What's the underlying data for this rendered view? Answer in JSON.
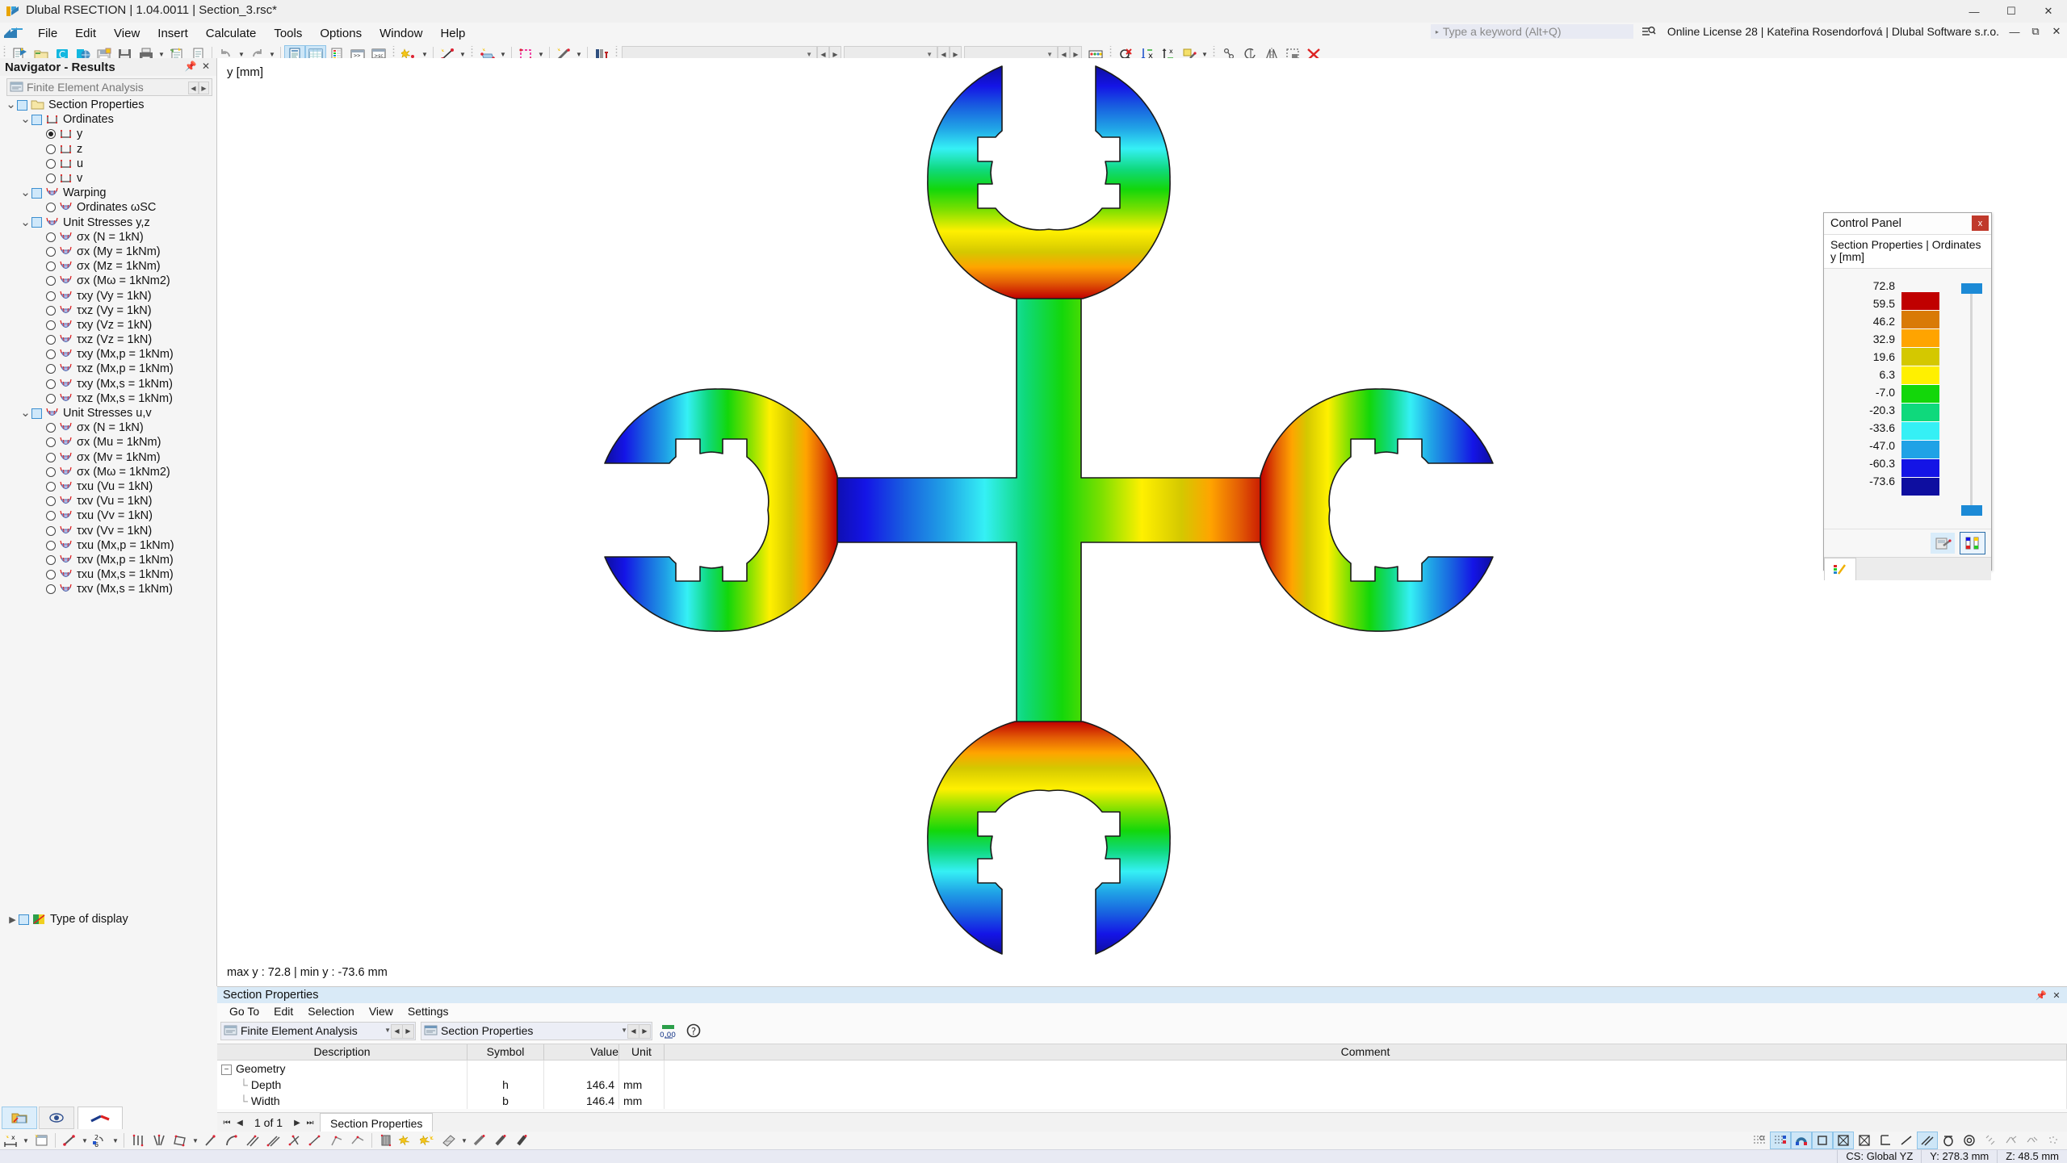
{
  "window": {
    "title": "Dlubal RSECTION | 1.04.0011 | Section_3.rsc*",
    "min_label": "—",
    "max_label": "☐",
    "close_label": "✕"
  },
  "menubar": {
    "items": [
      {
        "label": "File"
      },
      {
        "label": "Edit"
      },
      {
        "label": "View"
      },
      {
        "label": "Insert"
      },
      {
        "label": "Calculate"
      },
      {
        "label": "Tools"
      },
      {
        "label": "Options"
      },
      {
        "label": "Window"
      },
      {
        "label": "Help"
      }
    ]
  },
  "topright": {
    "search_placeholder": "Type a keyword (Alt+Q)",
    "license": "Online License 28 | Kateřina Rosendorfová | Dlubal Software s.r.o."
  },
  "navigator": {
    "title": "Navigator - Results",
    "pin_icon": "pin-icon",
    "close_icon": "close-icon",
    "combo_value": "Finite Element Analysis",
    "tree": [
      {
        "level": 0,
        "ctrl": "checkbox",
        "expander": "down",
        "icon": "folder-icon",
        "label": "Section Properties"
      },
      {
        "level": 1,
        "ctrl": "checkbox",
        "expander": "down",
        "icon": "section-icon",
        "label": "Ordinates"
      },
      {
        "level": 2,
        "ctrl": "radio-selected",
        "expander": "none",
        "icon": "section-icon",
        "label": "y"
      },
      {
        "level": 2,
        "ctrl": "radio",
        "expander": "none",
        "icon": "section-icon",
        "label": "z"
      },
      {
        "level": 2,
        "ctrl": "radio",
        "expander": "none",
        "icon": "section-icon",
        "label": "u"
      },
      {
        "level": 2,
        "ctrl": "radio",
        "expander": "none",
        "icon": "section-icon",
        "label": "v"
      },
      {
        "level": 1,
        "ctrl": "checkbox",
        "expander": "down",
        "icon": "stress-icon",
        "label": "Warping"
      },
      {
        "level": 2,
        "ctrl": "radio",
        "expander": "none",
        "icon": "stress-icon",
        "label": "Ordinates ωSC"
      },
      {
        "level": 1,
        "ctrl": "checkbox",
        "expander": "down",
        "icon": "stress-icon",
        "label": "Unit Stresses y,z"
      },
      {
        "level": 2,
        "ctrl": "radio",
        "expander": "none",
        "icon": "stress-icon",
        "label": "σx (N = 1kN)"
      },
      {
        "level": 2,
        "ctrl": "radio",
        "expander": "none",
        "icon": "stress-icon",
        "label": "σx (My = 1kNm)"
      },
      {
        "level": 2,
        "ctrl": "radio",
        "expander": "none",
        "icon": "stress-icon",
        "label": "σx (Mz = 1kNm)"
      },
      {
        "level": 2,
        "ctrl": "radio",
        "expander": "none",
        "icon": "stress-icon",
        "label": "σx (Mω = 1kNm2)"
      },
      {
        "level": 2,
        "ctrl": "radio",
        "expander": "none",
        "icon": "stress-icon",
        "label": "τxy (Vy = 1kN)"
      },
      {
        "level": 2,
        "ctrl": "radio",
        "expander": "none",
        "icon": "stress-icon",
        "label": "τxz (Vy = 1kN)"
      },
      {
        "level": 2,
        "ctrl": "radio",
        "expander": "none",
        "icon": "stress-icon",
        "label": "τxy (Vz = 1kN)"
      },
      {
        "level": 2,
        "ctrl": "radio",
        "expander": "none",
        "icon": "stress-icon",
        "label": "τxz (Vz = 1kN)"
      },
      {
        "level": 2,
        "ctrl": "radio",
        "expander": "none",
        "icon": "stress-icon",
        "label": "τxy (Mx,p = 1kNm)"
      },
      {
        "level": 2,
        "ctrl": "radio",
        "expander": "none",
        "icon": "stress-icon",
        "label": "τxz (Mx,p = 1kNm)"
      },
      {
        "level": 2,
        "ctrl": "radio",
        "expander": "none",
        "icon": "stress-icon",
        "label": "τxy (Mx,s = 1kNm)"
      },
      {
        "level": 2,
        "ctrl": "radio",
        "expander": "none",
        "icon": "stress-icon",
        "label": "τxz (Mx,s = 1kNm)"
      },
      {
        "level": 1,
        "ctrl": "checkbox",
        "expander": "down",
        "icon": "stress-icon",
        "label": "Unit Stresses u,v"
      },
      {
        "level": 2,
        "ctrl": "radio",
        "expander": "none",
        "icon": "stress-icon",
        "label": "σx (N = 1kN)"
      },
      {
        "level": 2,
        "ctrl": "radio",
        "expander": "none",
        "icon": "stress-icon",
        "label": "σx (Mu = 1kNm)"
      },
      {
        "level": 2,
        "ctrl": "radio",
        "expander": "none",
        "icon": "stress-icon",
        "label": "σx (Mv = 1kNm)"
      },
      {
        "level": 2,
        "ctrl": "radio",
        "expander": "none",
        "icon": "stress-icon",
        "label": "σx (Mω = 1kNm2)"
      },
      {
        "level": 2,
        "ctrl": "radio",
        "expander": "none",
        "icon": "stress-icon",
        "label": "τxu (Vu = 1kN)"
      },
      {
        "level": 2,
        "ctrl": "radio",
        "expander": "none",
        "icon": "stress-icon",
        "label": "τxv (Vu = 1kN)"
      },
      {
        "level": 2,
        "ctrl": "radio",
        "expander": "none",
        "icon": "stress-icon",
        "label": "τxu (Vv = 1kN)"
      },
      {
        "level": 2,
        "ctrl": "radio",
        "expander": "none",
        "icon": "stress-icon",
        "label": "τxv (Vv = 1kN)"
      },
      {
        "level": 2,
        "ctrl": "radio",
        "expander": "none",
        "icon": "stress-icon",
        "label": "τxu (Mx,p = 1kNm)"
      },
      {
        "level": 2,
        "ctrl": "radio",
        "expander": "none",
        "icon": "stress-icon",
        "label": "τxv (Mx,p = 1kNm)"
      },
      {
        "level": 2,
        "ctrl": "radio",
        "expander": "none",
        "icon": "stress-icon",
        "label": "τxu (Mx,s = 1kNm)"
      },
      {
        "level": 2,
        "ctrl": "radio",
        "expander": "none",
        "icon": "stress-icon",
        "label": "τxv (Mx,s = 1kNm)"
      }
    ],
    "type_of_display": {
      "label": "Type of display",
      "expander": "right",
      "icon": "display-icon"
    }
  },
  "view": {
    "axis_label": "y [mm]",
    "minmax_label": "max y : 72.8 | min y : -73.6 mm"
  },
  "control_panel": {
    "title": "Control Panel",
    "close_label": "x",
    "subtitle_line1": "Section Properties | Ordinates",
    "subtitle_line2": "y [mm]",
    "scale_values": [
      "72.8",
      "59.5",
      "46.2",
      "32.9",
      "19.6",
      "6.3",
      "-7.0",
      "-20.3",
      "-33.6",
      "-47.0",
      "-60.3",
      "-73.6"
    ],
    "scale_colors": [
      "#c00000",
      "#d97a06",
      "#ffa400",
      "#d4c800",
      "#fff000",
      "#13d70a",
      "#0fd97c",
      "#35f0f5",
      "#20a2e6",
      "#1414e6",
      "#0e0ea0"
    ],
    "footer_buttons": [
      {
        "name": "edit-colors-button",
        "icon": "palette-edit-icon"
      },
      {
        "name": "scale-settings-button",
        "icon": "color-scale-icon"
      }
    ],
    "tab_icon": "color-legend-icon"
  },
  "chart_data": {
    "type": "heatmap",
    "title": "Section Properties | Ordinates y [mm]",
    "ylabel": "y [mm]",
    "legend_position": "right",
    "value_min": -73.6,
    "value_max": 72.8,
    "tick_values": [
      72.8,
      59.5,
      46.2,
      32.9,
      19.6,
      6.3,
      -7.0,
      -20.3,
      -33.6,
      -47.0,
      -60.3,
      -73.6
    ],
    "band_colors": [
      "#c00000",
      "#d97a06",
      "#ffa400",
      "#d4c800",
      "#fff000",
      "#13d70a",
      "#0fd97c",
      "#35f0f5",
      "#20a2e6",
      "#1414e6",
      "#0e0ea0"
    ],
    "annotations": [
      "max y : 72.8 | min y : -73.6 mm"
    ],
    "description": "Cross-shaped thin-walled section with four C-profile lobes, colored by horizontal ordinate y from -73.6 mm (dark blue, left) to 72.8 mm (dark red, right)"
  },
  "table_panel": {
    "title": "Section Properties",
    "pin_icon": "pin-icon",
    "close_icon": "close-icon",
    "menu": [
      "Go To",
      "Edit",
      "Selection",
      "View",
      "Settings"
    ],
    "combo1": "Finite Element Analysis",
    "combo2": "Section Properties",
    "columns": [
      "Description",
      "Symbol",
      "Value",
      "Unit",
      "Comment"
    ],
    "rows": [
      {
        "type": "group",
        "description": "Geometry",
        "symbol": "",
        "value": "",
        "unit": "",
        "comment": ""
      },
      {
        "type": "item",
        "description": "Depth",
        "symbol": "h",
        "value": "146.4",
        "unit": "mm",
        "comment": ""
      },
      {
        "type": "item",
        "description": "Width",
        "symbol": "b",
        "value": "146.4",
        "unit": "mm",
        "comment": ""
      }
    ]
  },
  "bottom_tabs": {
    "page_text": "1 of 1",
    "first_icon": "first-page-icon",
    "prev_icon": "prev-page-icon",
    "next_icon": "next-page-icon",
    "last_icon": "last-page-icon",
    "tab_label": "Section Properties"
  },
  "statusbar": {
    "cs": "CS: Global YZ",
    "y": "Y: 278.3 mm",
    "z": "Z: 48.5 mm"
  }
}
